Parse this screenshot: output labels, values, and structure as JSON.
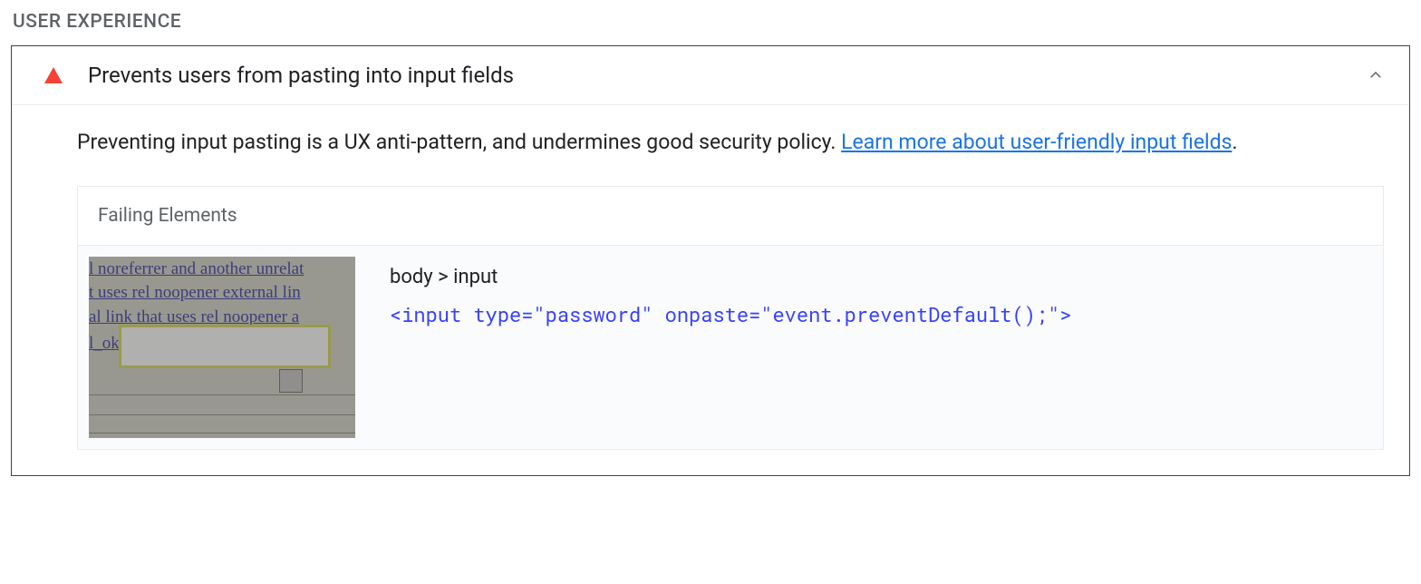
{
  "section": {
    "title": "USER EXPERIENCE"
  },
  "audit": {
    "title": "Prevents users from pasting into input fields",
    "description_prefix": "Preventing input pasting is a UX anti-pattern, and undermines good security policy. ",
    "learn_more_text": "Learn more about user-friendly input fields",
    "description_suffix": ".",
    "failing_header": "Failing Elements",
    "elements": [
      {
        "selector_path": "body > input",
        "snippet": "<input type=\"password\" onpaste=\"event.preventDefault();\">",
        "thumbnail_text": {
          "l1": "l noreferrer and another unrelat",
          "l2": "t uses rel noopener external lin",
          "l3": "al link that uses rel noopener a",
          "l4": "l_ok"
        }
      }
    ]
  }
}
